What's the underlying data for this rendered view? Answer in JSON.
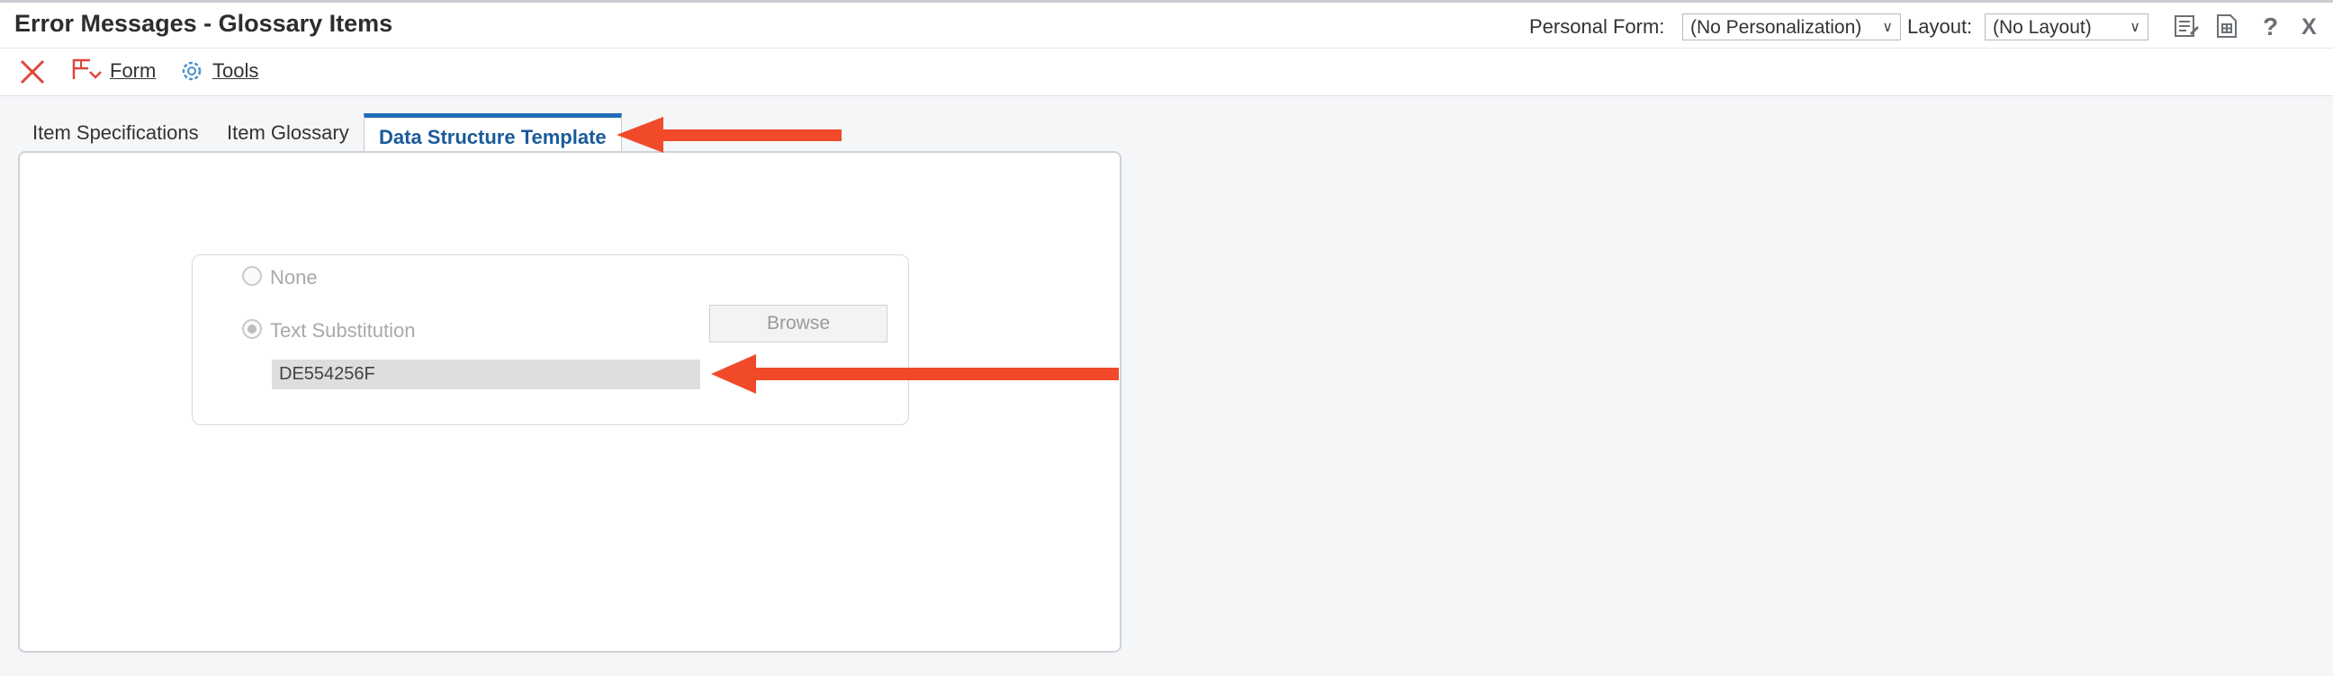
{
  "header": {
    "title": "Error Messages - Glossary Items",
    "personal_form_label": "Personal Form:",
    "personal_form_value": "(No Personalization)",
    "layout_label": "Layout:",
    "layout_value": "(No Layout)",
    "icons": [
      "notes-icon",
      "attachment-icon",
      "help-icon",
      "close-icon"
    ]
  },
  "toolbar": {
    "cancel_icon": "close-x-icon",
    "form_label": "Form",
    "form_accel": "F",
    "tools_label": "Tools",
    "tools_accel": "T"
  },
  "tabs": [
    {
      "label": "Item Specifications",
      "active": false
    },
    {
      "label": "Item Glossary",
      "active": false
    },
    {
      "label": "Data Structure Template",
      "active": true
    }
  ],
  "template": {
    "option_none": "None",
    "option_text_substitution": "Text Substitution",
    "selected_option": "Text Substitution",
    "browse_label": "Browse",
    "text_value": "DE554256F"
  },
  "annotations": {
    "arrow_color": "#f04a2a"
  },
  "colors": {
    "active_tab": "#1f6db5",
    "cancel_red": "#e0463a"
  }
}
